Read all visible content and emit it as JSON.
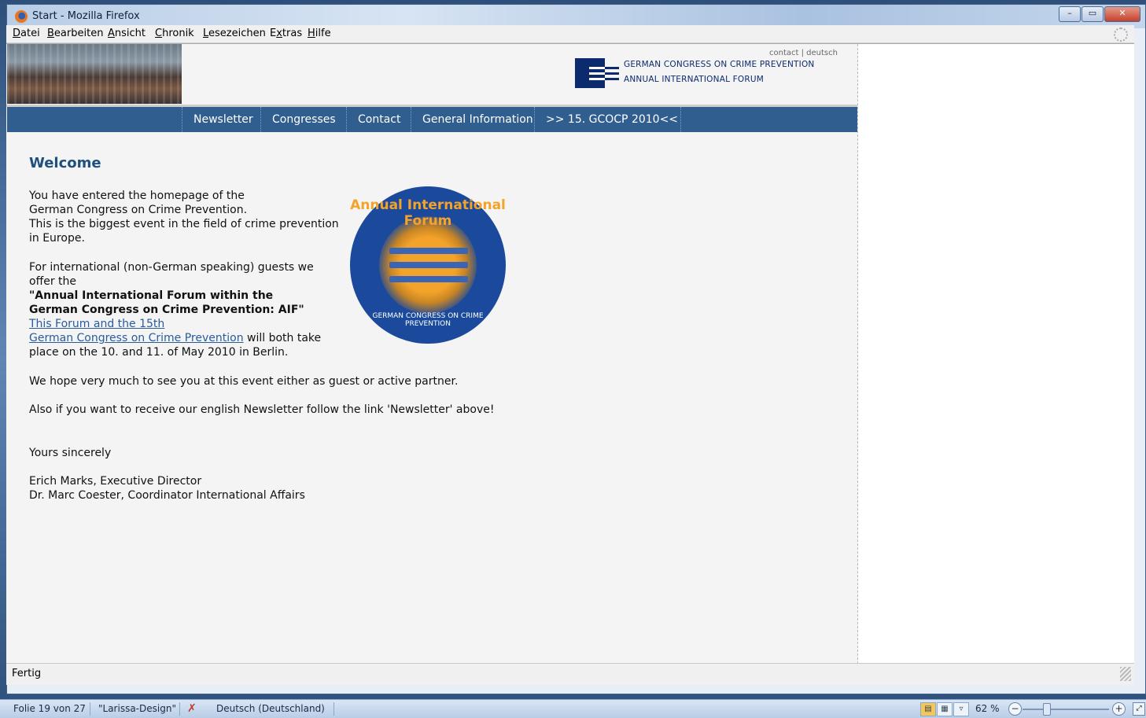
{
  "window": {
    "title": "Start - Mozilla Firefox"
  },
  "menubar": {
    "items": [
      {
        "label_u": "D",
        "label_rest": "atei"
      },
      {
        "label_u": "B",
        "label_rest": "earbeiten"
      },
      {
        "label_u": "A",
        "label_rest": "nsicht"
      },
      {
        "label_u": "C",
        "label_rest": "hronik"
      },
      {
        "label_u": "L",
        "label_rest": "esezeichen"
      },
      {
        "label_pre": "E",
        "label_u": "x",
        "label_rest": "tras"
      },
      {
        "label_u": "H",
        "label_rest": "ilfe"
      }
    ]
  },
  "header": {
    "toplinks": "contact | deutsch",
    "org_line1": "GERMAN CONGRESS ON CRIME PREVENTION",
    "org_line2": "ANNUAL INTERNATIONAL FORUM"
  },
  "nav": {
    "items": [
      "Newsletter",
      "Congresses",
      "Contact",
      "General Information",
      ">> 15. GCOCP 2010<<"
    ]
  },
  "main": {
    "heading": "Welcome",
    "p1": [
      "You have entered the homepage of the",
      "German Congress on Crime Prevention.",
      "This is the biggest event in the field of crime prevention",
      "in Europe."
    ],
    "p2_line1": "For international (non-German speaking) guests we",
    "p2_line2": "offer the",
    "p2_bold1": "\"Annual International Forum within the",
    "p2_bold2": "German Congress on Crime Prevention: AIF\"",
    "link1": "This Forum and the 15th",
    "link2": "German Congress on Crime Prevention",
    "p2_after_link": " will both take",
    "p2_last": "place on the 10. and 11. of May 2010 in Berlin.",
    "p3": "We hope very much to see you at this event either as guest or active partner.",
    "p4": "Also if you want to receive our english Newsletter follow the link 'Newsletter' above!",
    "closing": "Yours sincerely",
    "sig1": "Erich Marks, Executive Director",
    "sig2": "Dr. Marc Coester, Coordinator International Affairs"
  },
  "seal": {
    "top_text": "Annual International Forum",
    "bottom_text": "GERMAN CONGRESS ON CRIME PREVENTION"
  },
  "statusbar": {
    "text": "Fertig"
  },
  "taskbar": {
    "slide": "Folie 19 von 27",
    "design": "\"Larissa-Design\"",
    "language": "Deutsch (Deutschland)",
    "zoom": "62 %"
  }
}
